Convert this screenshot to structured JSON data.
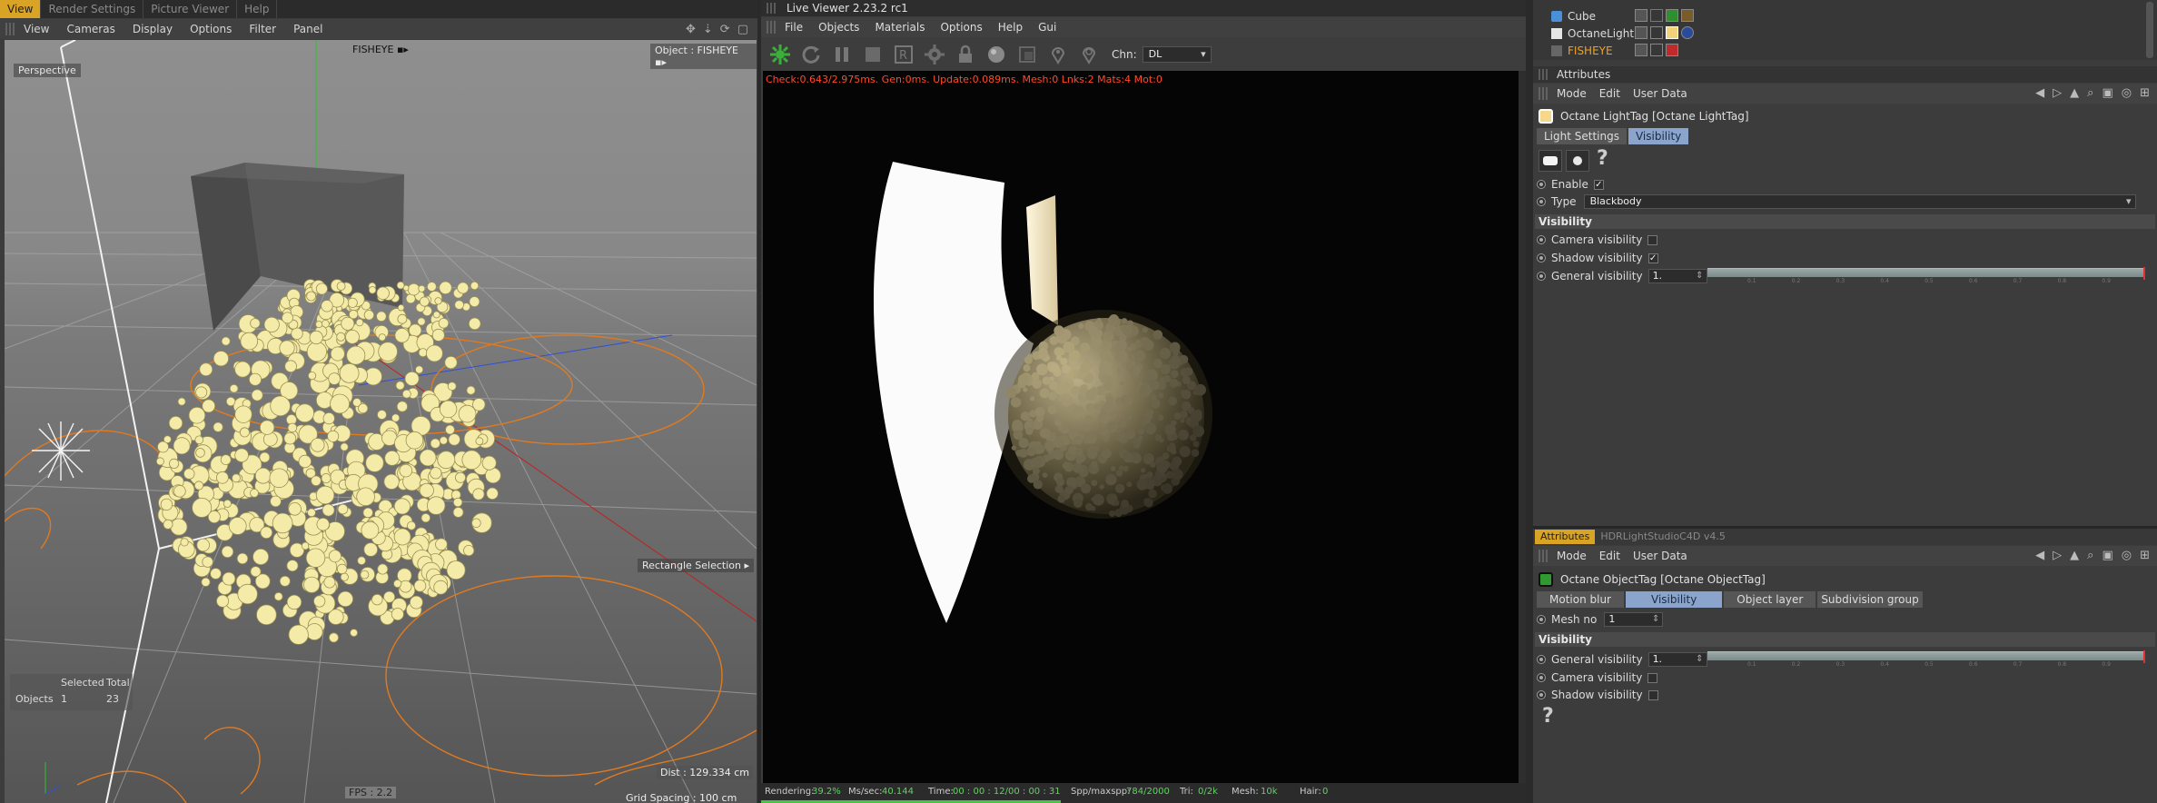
{
  "left": {
    "tabs": [
      "View",
      "Render Settings",
      "Picture Viewer",
      "Help"
    ],
    "menu": [
      "View",
      "Cameras",
      "Display",
      "Options",
      "Filter",
      "Panel"
    ],
    "perspective_label": "Perspective",
    "camera_name": "FISHEYE",
    "object_label": "Object : FISHEYE",
    "rect_selection": "Rectangle Selection",
    "table": {
      "selected_header": "Selected",
      "total_header": "Total",
      "row_label": "Objects",
      "selected": "1",
      "total": "23"
    },
    "dist": "Dist : 129.334 cm",
    "grid_spacing": "Grid Spacing : 100 cm",
    "fps": "FPS : 2.2"
  },
  "mid": {
    "title": "Live Viewer 2.23.2 rc1",
    "menu": [
      "File",
      "Objects",
      "Materials",
      "Options",
      "Help",
      "Gui"
    ],
    "chn_label": "Chn:",
    "chn_value": "DL",
    "render_status": "Check:0.643/2.975ms. Gen:0ms. Update:0.089ms. Mesh:0 Lnks:2 Mats:4 Mot:0",
    "status": {
      "rendering_label": "Rendering:",
      "rendering_value": "39.2%",
      "ms_label": "Ms/sec:",
      "ms_value": "40.144",
      "time_label": "Time:",
      "time_value": "00 : 00 : 12/00 : 00 : 31",
      "spp_label": "Spp/maxspp:",
      "spp_value": "784/2000",
      "tri_label": "Tri:",
      "tri_value": "0/2k",
      "mesh_label": "Mesh:",
      "mesh_value": "10k",
      "hair_label": "Hair:",
      "hair_value": "0"
    },
    "progress": 0.392
  },
  "right": {
    "objects": [
      {
        "name": "Cube",
        "color": "#dddddd"
      },
      {
        "name": "OctaneLight",
        "color": "#dddddd"
      },
      {
        "name": "FISHEYE",
        "color": "#f0a020"
      }
    ],
    "attr1": {
      "header": "Attributes",
      "menu": [
        "Mode",
        "Edit",
        "User Data"
      ],
      "tag_title": "Octane LightTag [Octane LightTag]",
      "tabs": [
        "Light Settings",
        "Visibility"
      ],
      "enable_label": "Enable",
      "type_label": "Type",
      "type_value": "Blackbody",
      "section": "Visibility",
      "camera_vis": "Camera visibility",
      "shadow_vis": "Shadow visibility",
      "general_vis": "General visibility",
      "general_value": "1.",
      "enable_checked": "✓",
      "shadow_checked": "✓"
    },
    "attr2": {
      "tabs": [
        "Attributes",
        "HDRLightStudioC4D v4.5"
      ],
      "menu": [
        "Mode",
        "Edit",
        "User Data"
      ],
      "tag_title": "Octane ObjectTag [Octane ObjectTag]",
      "tabs2": [
        "Motion blur",
        "Visibility",
        "Object layer",
        "Subdivision group"
      ],
      "mesh_label": "Mesh no",
      "mesh_value": "1",
      "section": "Visibility",
      "general_vis": "General visibility",
      "general_value": "1.",
      "camera_vis": "Camera visibility",
      "shadow_vis": "Shadow visibility"
    },
    "slider_ticks": [
      "0.1",
      "0.2",
      "0.3",
      "0.4",
      "0.5",
      "0.6",
      "0.7",
      "0.8",
      "0.9"
    ]
  },
  "colors": {
    "accent": "#d9a326",
    "tab_selected": "#8aa4cc",
    "status_red": "#ff4a2a",
    "progress_green": "#49c449"
  }
}
